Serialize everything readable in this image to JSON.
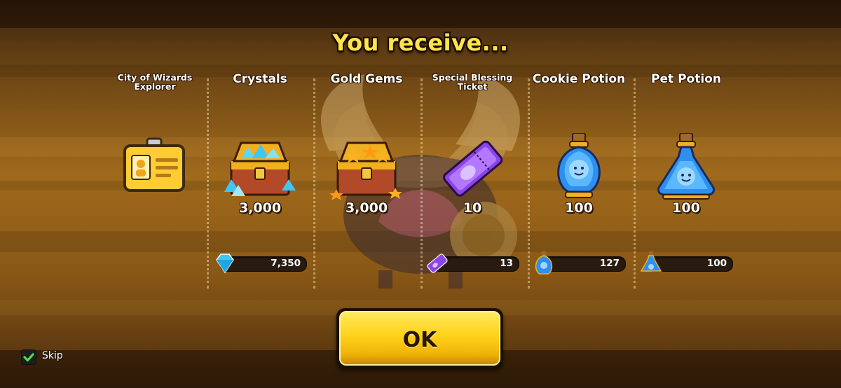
{
  "header": {
    "title": "You receive..."
  },
  "rewards": [
    {
      "name": "City of Wizards Explorer",
      "amount": "",
      "held": "",
      "icon": "id-badge-icon"
    },
    {
      "name": "Crystals",
      "amount": "3,000",
      "held": "7,350",
      "icon": "crystal-chest-icon"
    },
    {
      "name": "Gold Gems",
      "amount": "3,000",
      "held": "",
      "icon": "gold-gem-chest-icon"
    },
    {
      "name": "Special Blessing Ticket",
      "amount": "10",
      "held": "13",
      "icon": "blessing-ticket-icon"
    },
    {
      "name": "Cookie Potion",
      "amount": "100",
      "held": "127",
      "icon": "cookie-potion-icon"
    },
    {
      "name": "Pet Potion",
      "amount": "100",
      "held": "100",
      "icon": "pet-potion-icon"
    }
  ],
  "footer": {
    "ok_label": "OK",
    "skip_label": "Skip",
    "skip_checked": true
  },
  "colors": {
    "title": "#ffe54a",
    "button": "#ffd21a",
    "crystal": "#3fc6f2",
    "gold": "#f7a21b",
    "ticket": "#8a44e8"
  }
}
